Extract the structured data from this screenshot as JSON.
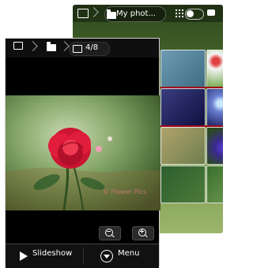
{
  "back_screen": {
    "title": "My phot...",
    "icons": [
      "image-icon",
      "folder-icon",
      "grid-icon",
      "toggle-icon",
      "message-icon"
    ]
  },
  "front_screen": {
    "counter": "4/8",
    "zoom_out_icon": "zoom-out-icon",
    "zoom_in_icon": "zoom-in-icon",
    "slideshow_label": "Slideshow",
    "menu_label": "Menu",
    "watermark": "© Flower Pics"
  },
  "colors": {
    "background": "#ffffff",
    "front_bg": "#000000",
    "accent_red": "#a40a1a"
  }
}
